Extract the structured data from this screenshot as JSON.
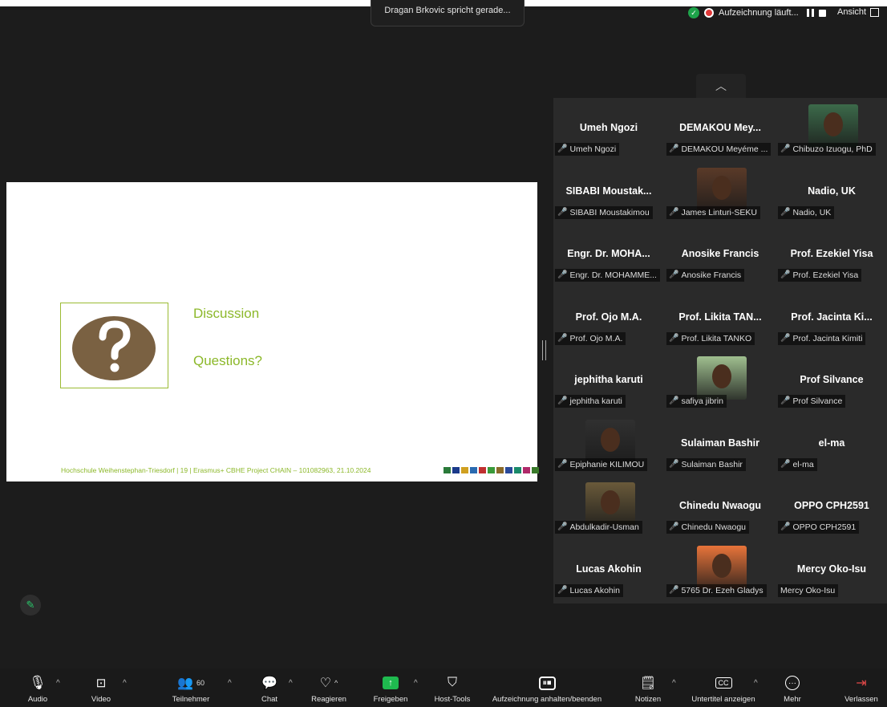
{
  "header": {
    "speaker_text": "Dragan Brkovic spricht gerade...",
    "recording_text": "Aufzeichnung läuft...",
    "view_label": "Ansicht"
  },
  "slide": {
    "title": "Discussion",
    "subtitle": "Questions?",
    "footer": "Hochschule Weihenstephan-Triesdorf  |  19 | Erasmus+ CBHE Project CHAIN – 101082963, 21.10.2024"
  },
  "participants": [
    {
      "name": "Umeh Ngozi",
      "label": "Umeh Ngozi",
      "muted": true,
      "photo": false
    },
    {
      "name": "DEMAKOU  Mey...",
      "label": "DEMAKOU Meyéme ...",
      "muted": true,
      "photo": false
    },
    {
      "name": "",
      "label": "Chibuzo Izuogu, PhD",
      "muted": true,
      "photo": true,
      "photo_color": "#3c6a4a"
    },
    {
      "name": "SIBABI  Moustak...",
      "label": "SIBABI Moustakimou",
      "muted": true,
      "photo": false
    },
    {
      "name": "",
      "label": "James Linturi-SEKU",
      "muted": true,
      "photo": true,
      "photo_color": "#5a3a28"
    },
    {
      "name": "Nadio, UK",
      "label": "Nadio, UK",
      "muted": true,
      "photo": false
    },
    {
      "name": "Engr.  Dr.  MOHA...",
      "label": "Engr. Dr. MOHAMME...",
      "muted": true,
      "photo": false
    },
    {
      "name": "Anosike Francis",
      "label": "Anosike Francis",
      "muted": true,
      "photo": false
    },
    {
      "name": "Prof. Ezekiel Yisa",
      "label": "Prof. Ezekiel Yisa",
      "muted": true,
      "photo": false
    },
    {
      "name": "Prof.  Ojo M.A.",
      "label": "Prof. Ojo M.A.",
      "muted": true,
      "photo": false
    },
    {
      "name": "Prof.  Likita TAN...",
      "label": "Prof. Likita TANKO",
      "muted": true,
      "photo": false
    },
    {
      "name": "Prof.  Jacinta Ki...",
      "label": "Prof. Jacinta Kimiti",
      "muted": true,
      "photo": false
    },
    {
      "name": "jephitha karuti",
      "label": "jephitha karuti",
      "muted": true,
      "photo": false
    },
    {
      "name": "",
      "label": "safiya jibrin",
      "muted": true,
      "photo": true,
      "photo_color": "#9fbf8f"
    },
    {
      "name": "Prof Silvance",
      "label": "Prof Silvance",
      "muted": true,
      "photo": false
    },
    {
      "name": "",
      "label": "Epiphanie KILIMOU",
      "muted": true,
      "photo": true,
      "photo_color": "#303030"
    },
    {
      "name": "Sulaiman Bashir",
      "label": "Sulaiman Bashir",
      "muted": true,
      "photo": false
    },
    {
      "name": "el-ma",
      "label": "el-ma",
      "muted": true,
      "photo": false
    },
    {
      "name": "",
      "label": "Abdulkadir-Usman",
      "muted": true,
      "photo": true,
      "photo_color": "#6a5a3a"
    },
    {
      "name": "Chinedu Nwaogu",
      "label": "Chinedu Nwaogu",
      "muted": true,
      "photo": false
    },
    {
      "name": "OPPO CPH2591",
      "label": "OPPO CPH2591",
      "muted": true,
      "photo": false
    },
    {
      "name": "Lucas Akohin",
      "label": "Lucas Akohin",
      "muted": true,
      "photo": false
    },
    {
      "name": "",
      "label": "5765 Dr. Ezeh Gladys",
      "muted": true,
      "photo": true,
      "photo_color": "#e8743a"
    },
    {
      "name": "Mercy Oko-Isu",
      "label": "Mercy Oko-Isu",
      "muted": false,
      "photo": false
    }
  ],
  "toolbar": {
    "audio": "Audio",
    "video": "Video",
    "participants": "Teilnehmer",
    "participants_count": "60",
    "chat": "Chat",
    "react": "Reagieren",
    "share": "Freigeben",
    "host_tools": "Host-Tools",
    "recording": "Aufzeichnung anhalten/beenden",
    "notes": "Notizen",
    "captions": "Untertitel anzeigen",
    "captions_icon_text": "CC",
    "more": "Mehr",
    "leave": "Verlassen"
  }
}
